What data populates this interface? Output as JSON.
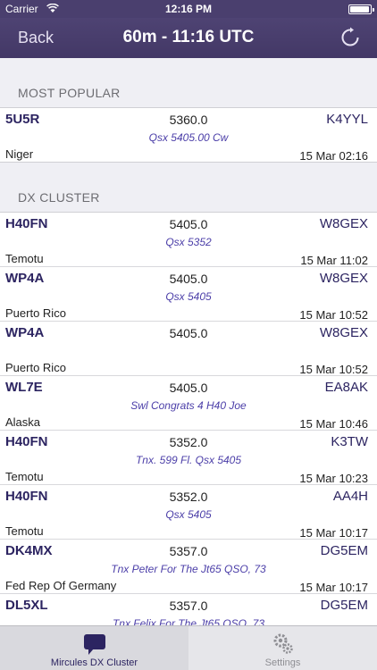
{
  "status": {
    "carrier": "Carrier",
    "time": "12:16 PM"
  },
  "nav": {
    "back_label": "Back",
    "title": "60m - 11:16 UTC"
  },
  "sections": {
    "popular": {
      "header": "MOST POPULAR",
      "rows": [
        {
          "call": "5U5R",
          "freq": "5360.0",
          "spotter": "K4YYL",
          "comment": "Qsx 5405.00 Cw",
          "country": "Niger",
          "date": "15 Mar 02:16"
        }
      ]
    },
    "cluster": {
      "header": "DX CLUSTER",
      "rows": [
        {
          "call": "H40FN",
          "freq": "5405.0",
          "spotter": "W8GEX",
          "comment": "Qsx 5352",
          "country": "Temotu",
          "date": "15 Mar 11:02"
        },
        {
          "call": "WP4A",
          "freq": "5405.0",
          "spotter": "W8GEX",
          "comment": "Qsx 5405",
          "country": "Puerto Rico",
          "date": "15 Mar 10:52"
        },
        {
          "call": "WP4A",
          "freq": "5405.0",
          "spotter": "W8GEX",
          "comment": "",
          "country": "Puerto Rico",
          "date": "15 Mar 10:52"
        },
        {
          "call": "WL7E",
          "freq": "5405.0",
          "spotter": "EA8AK",
          "comment": "Swl Congrats 4 H40 Joe",
          "country": "Alaska",
          "date": "15 Mar 10:46"
        },
        {
          "call": "H40FN",
          "freq": "5352.0",
          "spotter": "K3TW",
          "comment": "Tnx. 599 Fl. Qsx 5405",
          "country": "Temotu",
          "date": "15 Mar 10:23"
        },
        {
          "call": "H40FN",
          "freq": "5352.0",
          "spotter": "AA4H",
          "comment": "Qsx 5405",
          "country": "Temotu",
          "date": "15 Mar 10:17"
        },
        {
          "call": "DK4MX",
          "freq": "5357.0",
          "spotter": "DG5EM",
          "comment": "Tnx Peter For The Jt65 QSO, 73",
          "country": "Fed Rep Of Germany",
          "date": "15 Mar 10:17"
        },
        {
          "call": "DL5XL",
          "freq": "5357.0",
          "spotter": "DG5EM",
          "comment": "Tnx Felix For The Jt65 QSO, 73",
          "country": "",
          "date": ""
        }
      ]
    }
  },
  "tabs": [
    {
      "label": "Mircules DX Cluster",
      "icon": "chat-bubble-icon",
      "active": true
    },
    {
      "label": "Settings",
      "icon": "gears-icon",
      "active": false
    }
  ],
  "colors": {
    "nav_bg": "#4a3f6e",
    "callsign": "#2c2461",
    "comment": "#4b3ea8"
  }
}
